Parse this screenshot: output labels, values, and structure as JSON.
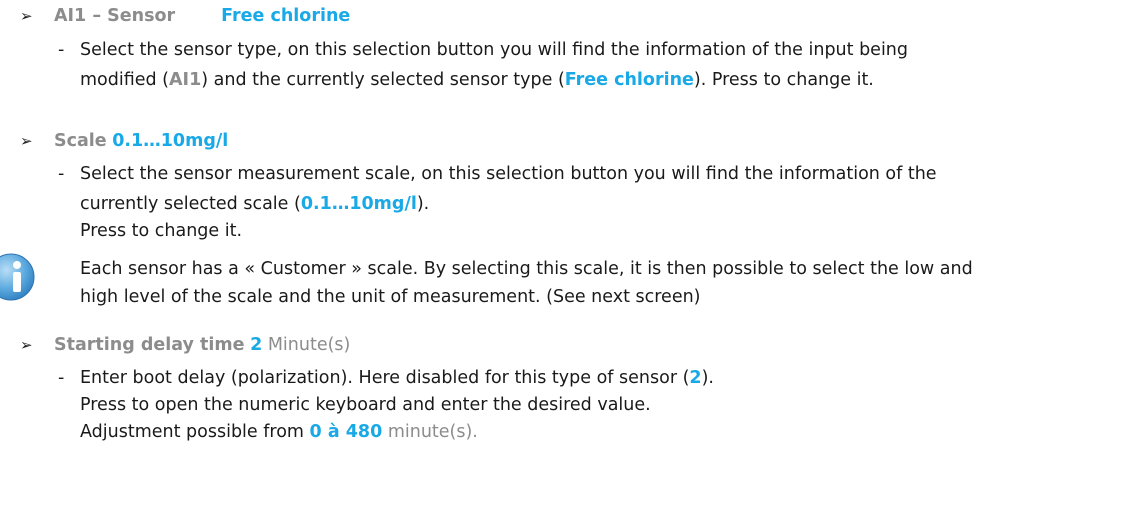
{
  "section_ai1": {
    "bullet": "➢",
    "label": "AI1 – Sensor",
    "value": "Free chlorine",
    "dash": "-",
    "desc1": "Select the sensor type, on this selection button you will find the information of the input being",
    "desc2_a": "modified (",
    "desc2_b": "AI1",
    "desc2_c": ") and the currently selected sensor type (",
    "desc2_d": "Free chlorine",
    "desc2_e": "). Press to change it."
  },
  "section_scale": {
    "bullet": "➢",
    "label": "Scale",
    "value": "0.1…10mg/l",
    "dash": "-",
    "desc1": "Select the sensor measurement scale, on this selection button you will find the information of the",
    "desc2_a": "currently selected scale (",
    "desc2_b": "0.1…10mg/l",
    "desc2_c": ").",
    "desc3": "Press to change it."
  },
  "note": {
    "icon": "info-icon",
    "line1": "Each sensor has a « Customer » scale. By selecting this scale, it is then possible to select the low and",
    "line2": "high level of the scale and the unit of measurement. (See next screen)"
  },
  "section_delay": {
    "bullet": "➢",
    "label": "Starting delay time",
    "value": "2",
    "unit": "Minute(s)",
    "dash": "-",
    "desc1_a": "Enter boot delay (polarization). Here disabled for this type of sensor (",
    "desc1_b": "2",
    "desc1_c": ").",
    "desc2": "Press to open the numeric keyboard and enter the desired value.",
    "desc3_a": "Adjustment possible from ",
    "desc3_b": "0 à 480",
    "desc3_c": " minute(s)."
  }
}
